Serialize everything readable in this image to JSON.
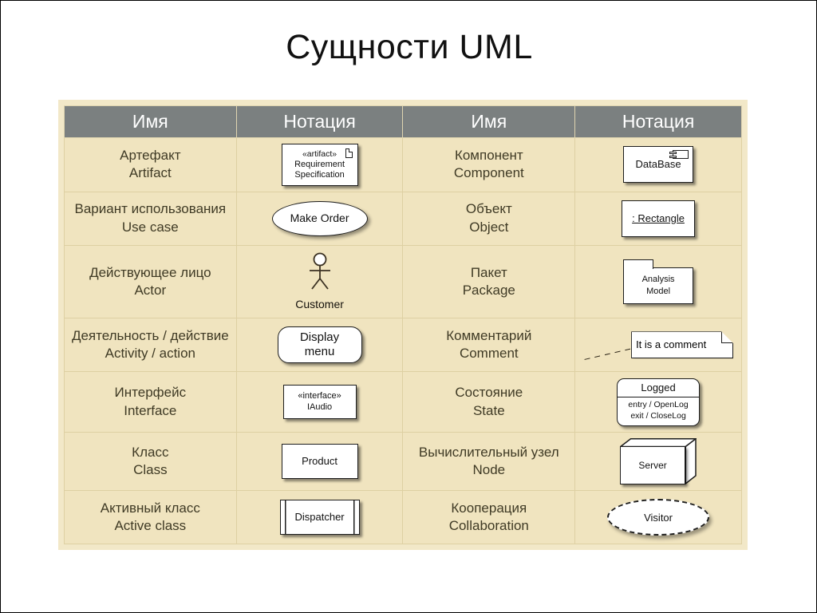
{
  "slide": {
    "title": "Сущности UML"
  },
  "table": {
    "headers": [
      "Имя",
      "Нотация",
      "Имя",
      "Нотация"
    ],
    "rows": [
      {
        "left": {
          "ru": "Артефакт",
          "en": "Artifact",
          "notation": {
            "kind": "artifact-box",
            "stereotype": "«artifact»",
            "line1": "Requirement",
            "line2": "Specification"
          }
        },
        "right": {
          "ru": "Компонент",
          "en": "Component",
          "notation": {
            "kind": "component-box",
            "name": "DataBase"
          }
        }
      },
      {
        "left": {
          "ru": "Вариант использования",
          "en": "Use case",
          "notation": {
            "kind": "use-case-ellipse",
            "name": "Make Order"
          }
        },
        "right": {
          "ru": "Объект",
          "en": "Object",
          "notation": {
            "kind": "object-box",
            "name": ": Rectangle"
          }
        }
      },
      {
        "left": {
          "ru": "Действующее лицо",
          "en": "Actor",
          "notation": {
            "kind": "actor-stick-figure",
            "name": "Customer"
          }
        },
        "right": {
          "ru": "Пакет",
          "en": "Package",
          "notation": {
            "kind": "package-folder",
            "line1": "Analysis",
            "line2": "Model"
          }
        }
      },
      {
        "left": {
          "ru": "Деятельность / действие",
          "en": "Activity / action",
          "notation": {
            "kind": "activity-rounded-box",
            "line1": "Display",
            "line2": "menu"
          }
        },
        "right": {
          "ru": "Комментарий",
          "en": "Comment",
          "notation": {
            "kind": "comment-note",
            "name": "It is a comment"
          }
        }
      },
      {
        "left": {
          "ru": "Интерфейс",
          "en": "Interface",
          "notation": {
            "kind": "interface-box",
            "stereotype": "«interface»",
            "name": "IAudio"
          }
        },
        "right": {
          "ru": "Состояние",
          "en": "State",
          "notation": {
            "kind": "state-rounded-box",
            "name": "Logged",
            "line1": "entry / OpenLog",
            "line2": "exit / CloseLog"
          }
        }
      },
      {
        "left": {
          "ru": "Класс",
          "en": "Class",
          "notation": {
            "kind": "class-box",
            "name": "Product"
          }
        },
        "right": {
          "ru": "Вычислительный узел",
          "en": "Node",
          "notation": {
            "kind": "node-3d-box",
            "name": "Server"
          }
        }
      },
      {
        "left": {
          "ru": "Активный класс",
          "en": "Active class",
          "notation": {
            "kind": "active-class-box",
            "name": "Dispatcher"
          }
        },
        "right": {
          "ru": "Кооперация",
          "en": "Collaboration",
          "notation": {
            "kind": "collaboration-dashed-ellipse",
            "name": "Visitor"
          }
        }
      }
    ]
  },
  "colors": {
    "header_bg": "#7b8080",
    "cell_bg": "#f0e4bf",
    "frame_bg": "#f2e8c8",
    "grid_line": "#ded0a3",
    "label_text": "#3f3a25",
    "shape_stroke": "#1d1d1d"
  }
}
